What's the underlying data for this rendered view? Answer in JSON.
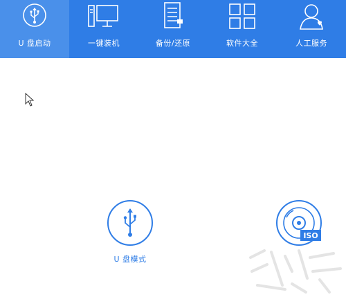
{
  "nav": {
    "items": [
      {
        "label": "U 盘启动",
        "icon": "usb-icon",
        "active": true
      },
      {
        "label": "一键装机",
        "icon": "desktop-computer-icon",
        "active": false
      },
      {
        "label": "备份/还原",
        "icon": "backup-document-icon",
        "active": false
      },
      {
        "label": "软件大全",
        "icon": "app-grid-icon",
        "active": false
      },
      {
        "label": "人工服务",
        "icon": "customer-service-person-icon",
        "active": false
      }
    ],
    "background": "#2f7de6",
    "active_background": "#4a90ea"
  },
  "modes": {
    "usb": {
      "label": "U 盘模式",
      "icon": "usb-circle-icon"
    },
    "iso": {
      "label": "",
      "badge": "ISO",
      "icon": "iso-disc-icon"
    }
  },
  "colors": {
    "accent": "#2f7de6",
    "text_white": "#ffffff"
  }
}
